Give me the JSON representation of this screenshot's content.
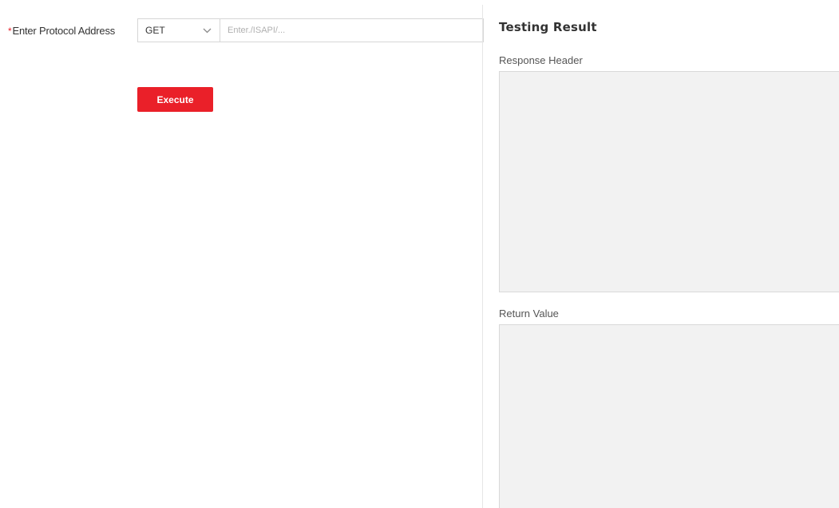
{
  "form": {
    "required_mark": "*",
    "protocol_label": "Enter Protocol Address",
    "method": {
      "selected": "GET",
      "icon": "chevron-down-icon"
    },
    "address": {
      "value": "",
      "placeholder": "Enter./ISAPI/..."
    },
    "execute_label": "Execute"
  },
  "result": {
    "title": "Testing Result",
    "response_header_label": "Response Header",
    "response_header_value": "",
    "return_value_label": "Return Value",
    "return_value_value": ""
  },
  "colors": {
    "accent": "#ea2029",
    "required": "#e8202a",
    "box_background": "#f2f2f2",
    "border": "#d6d6d6"
  }
}
